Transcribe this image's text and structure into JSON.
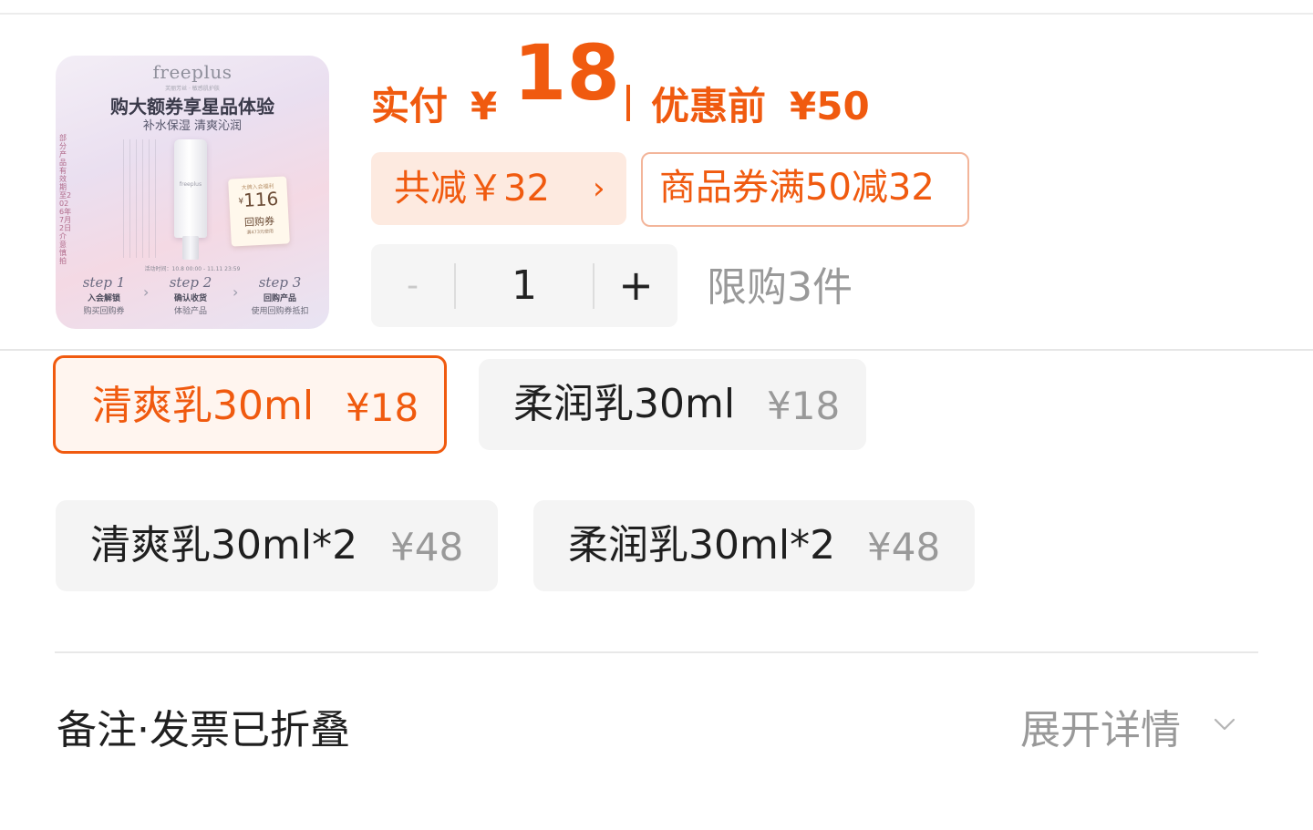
{
  "product_image": {
    "brand": "freeplus",
    "brand_sub": "芙丽芳丝 · 敏感肌护肤",
    "headline": "购大额券享星品体验",
    "subline": "补水保湿 清爽沁润",
    "side_text": "部分产品有效期至2026年7月2日 介意慎拍",
    "bottle_brand": "freeplus",
    "coupon": {
      "top": "大牌入会福利",
      "yen": "¥",
      "value": "116",
      "label": "回购券",
      "note": "满473元使用"
    },
    "date_line": "活动时间：10.8 00:00 - 11.11 23:59",
    "steps": [
      {
        "name": "step 1",
        "title": "入会解锁",
        "desc": "购买回购券"
      },
      {
        "name": "step 2",
        "title": "确认收货",
        "desc": "体验产品"
      },
      {
        "name": "step 3",
        "title": "回购产品",
        "desc": "使用回购券抵扣"
      }
    ],
    "arrow": "›"
  },
  "price": {
    "label": "实付",
    "currency": "¥",
    "value": "18",
    "original_label": "优惠前",
    "original_value": "¥50",
    "accent_color": "#f05a0f"
  },
  "discount": {
    "label": "共减￥32",
    "chevron": "›"
  },
  "coupon": {
    "label": "商品券满50减32"
  },
  "quantity": {
    "minus": "-",
    "value": "1",
    "plus": "+",
    "limit_text": "限购3件"
  },
  "skus": [
    {
      "name": "清爽乳30ml",
      "price": "¥18",
      "selected": true
    },
    {
      "name": "柔润乳30ml",
      "price": "¥18",
      "selected": false
    },
    {
      "name": "清爽乳30ml*2",
      "price": "¥48",
      "selected": false
    },
    {
      "name": "柔润乳30ml*2",
      "price": "¥48",
      "selected": false
    }
  ],
  "notes": {
    "label": "备注·发票已折叠",
    "expand_label": "展开详情",
    "expand_icon": "chevron-down-icon"
  }
}
